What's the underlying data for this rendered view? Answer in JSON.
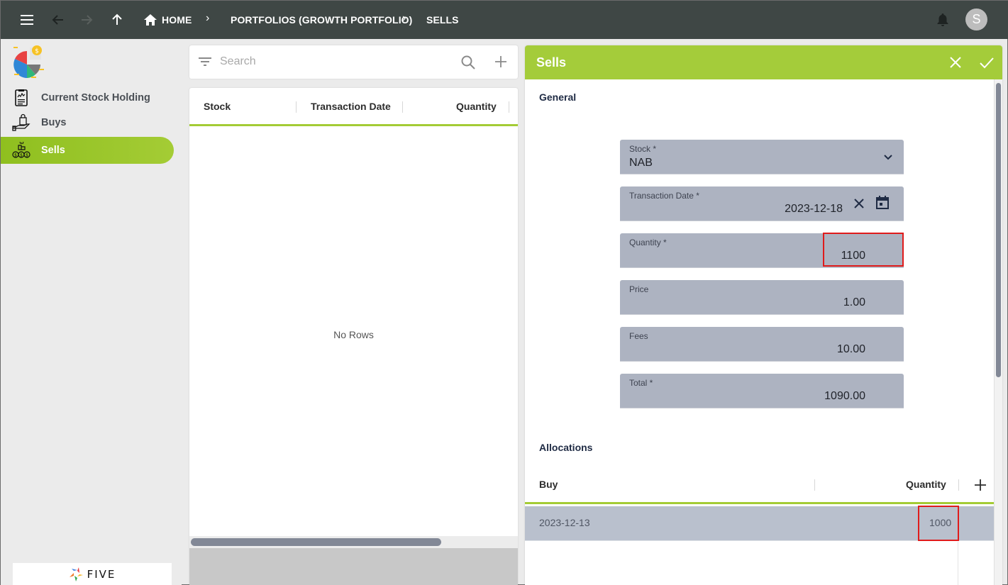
{
  "topbar": {
    "menu_icon": "hamburger-menu-icon",
    "back_icon": "arrow-left-icon",
    "forward_icon": "arrow-right-icon",
    "up_icon": "arrow-up-icon",
    "breadcrumbs": [
      {
        "label": "HOME",
        "icon": "home-icon"
      },
      {
        "label": "PORTFOLIOS (GROWTH PORTFOLIO)"
      },
      {
        "label": "SELLS"
      }
    ],
    "separator": "›",
    "notification_icon": "bell-icon",
    "avatar_initial": "S"
  },
  "sidebar": {
    "logo": "portfolio-pie-chart-logo",
    "items": [
      {
        "label": "Current Stock Holding",
        "icon": "clipboard-chart-icon",
        "active": false
      },
      {
        "label": "Buys",
        "icon": "hand-shopping-bag-icon",
        "active": false
      },
      {
        "label": "Sells",
        "icon": "money-sell-icon",
        "active": true
      }
    ],
    "footer_brand": "FIVE"
  },
  "list": {
    "search_placeholder": "Search",
    "columns": [
      "Stock",
      "Transaction Date",
      "Quantity"
    ],
    "empty_message": "No Rows"
  },
  "form": {
    "title": "Sells",
    "general_section": "General",
    "fields": {
      "stock": {
        "label": "Stock *",
        "value": "NAB"
      },
      "transaction_date": {
        "label": "Transaction Date *",
        "value": "2023-12-18"
      },
      "quantity": {
        "label": "Quantity *",
        "value": "1100"
      },
      "price": {
        "label": "Price",
        "value": "1.00"
      },
      "fees": {
        "label": "Fees",
        "value": "10.00"
      },
      "total": {
        "label": "Total *",
        "value": "1090.00"
      }
    },
    "allocations_section": "Allocations",
    "allocations": {
      "columns": [
        "Buy",
        "Quantity"
      ],
      "rows": [
        {
          "buy": "2023-12-13",
          "quantity": "1000"
        }
      ]
    }
  },
  "colors": {
    "accent": "#a4cc3a",
    "topbar": "#3f4745",
    "field_bg": "#adb3c1",
    "highlight": "#e01b1b"
  }
}
